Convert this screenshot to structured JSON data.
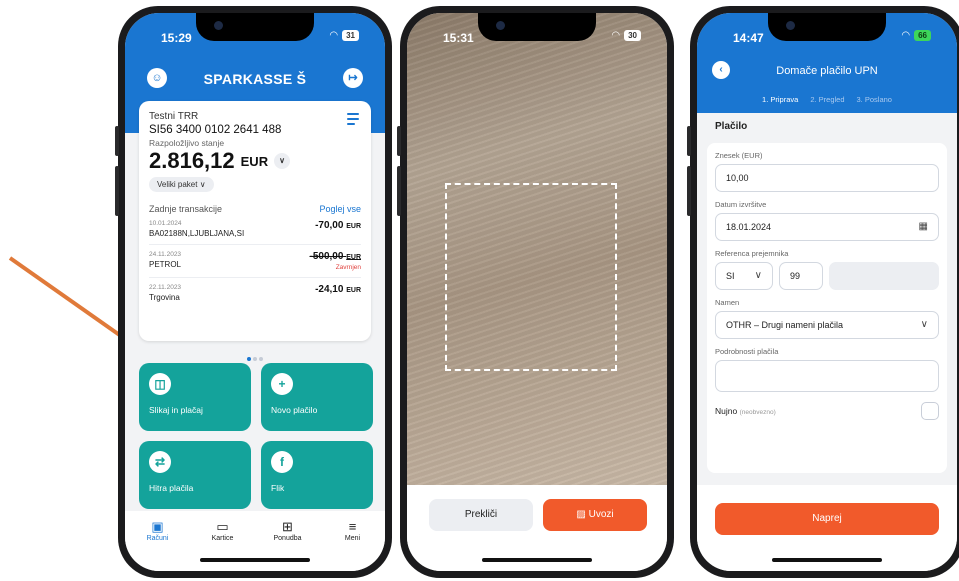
{
  "phone1": {
    "status_time": "15:29",
    "battery": "31",
    "brand": "SPARKASSE",
    "brand_mark": "Š",
    "account": {
      "name": "Testni TRR",
      "iban": "SI56 3400 0102 2641 488",
      "balance_label": "Razpoložljivo stanje",
      "balance": "2.816,12",
      "currency": "EUR",
      "package": "Veliki paket"
    },
    "transactions_title": "Zadnje transakcije",
    "view_all": "Poglej vse",
    "transactions": [
      {
        "date": "10.01.2024",
        "payee": "BA02188N,LJUBLJANA,SI",
        "amount": "-70,00",
        "unit": "EUR",
        "status": ""
      },
      {
        "date": "24.11.2023",
        "payee": "PETROL",
        "amount": "-500,00",
        "unit": "EUR",
        "status": "Zavrnjen"
      },
      {
        "date": "22.11.2023",
        "payee": "Trgovina",
        "amount": "-24,10",
        "unit": "EUR",
        "status": ""
      }
    ],
    "tiles": [
      {
        "label": "Slikaj in plačaj",
        "icon": "◫"
      },
      {
        "label": "Novo plačilo",
        "icon": "+"
      },
      {
        "label": "Hitra plačila",
        "icon": "⇄"
      },
      {
        "label": "Flik",
        "icon": "f"
      }
    ],
    "tabs": [
      {
        "label": "Računi",
        "icon": "▣"
      },
      {
        "label": "Kartice",
        "icon": "▭"
      },
      {
        "label": "Ponudba",
        "icon": "⊞"
      },
      {
        "label": "Meni",
        "icon": "≡"
      }
    ]
  },
  "phone2": {
    "status_time": "15:31",
    "battery": "30",
    "cancel_label": "Prekliči",
    "import_label": "Uvozi",
    "import_icon": "▨"
  },
  "phone3": {
    "status_time": "14:47",
    "battery": "66",
    "title": "Domače plačilo UPN",
    "steps": [
      "1. Priprava",
      "2. Pregled",
      "3. Poslano"
    ],
    "section": "Plačilo",
    "fields": {
      "amount_label": "Znesek (EUR)",
      "amount_value": "10,00",
      "date_label": "Datum izvršitve",
      "date_value": "18.01.2024",
      "ref_label": "Referenca prejemnika",
      "ref_country": "SI",
      "ref_model": "99",
      "ref_number": "",
      "purpose_label": "Namen",
      "purpose_value": "OTHR – Drugi nameni plačila",
      "details_label": "Podrobnosti plačila",
      "details_value": "",
      "urgent_label": "Nujno",
      "urgent_optional": "(neobvezno)"
    },
    "submit_label": "Naprej"
  },
  "colors": {
    "primary_blue": "#1a76d1",
    "teal": "#14a39b",
    "orange": "#f15a2b",
    "arrow": "#e07a3a"
  }
}
